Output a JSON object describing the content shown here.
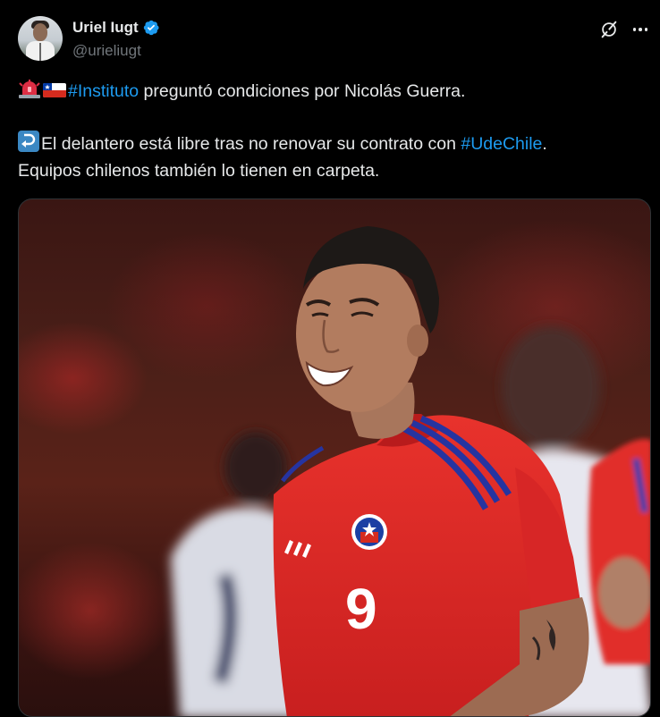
{
  "author": {
    "name": "Uriel Iugt",
    "handle": "@urieliugt",
    "verified": true
  },
  "icons": {
    "verified": "verified-badge-icon",
    "grok": "grok-icon",
    "more": "more-options-icon",
    "siren": "police-light-emoji",
    "flag": "chile-flag-emoji",
    "return": "right-arrow-curving-left-emoji"
  },
  "colors": {
    "link": "#1d9bf0",
    "background": "#000000",
    "text": "#e7e9ea",
    "muted": "#71767b"
  },
  "tweet": {
    "line1": {
      "hashtag": "#Instituto",
      "text": " preguntó condiciones por Nicolás Guerra."
    },
    "line2": {
      "text": "El delantero está libre tras no renovar su contrato con ",
      "hashtag": "#UdeChile",
      "end": "."
    },
    "line3": "Equipos chilenos también lo tienen en carpeta."
  },
  "media": {
    "jersey_number": "9"
  }
}
